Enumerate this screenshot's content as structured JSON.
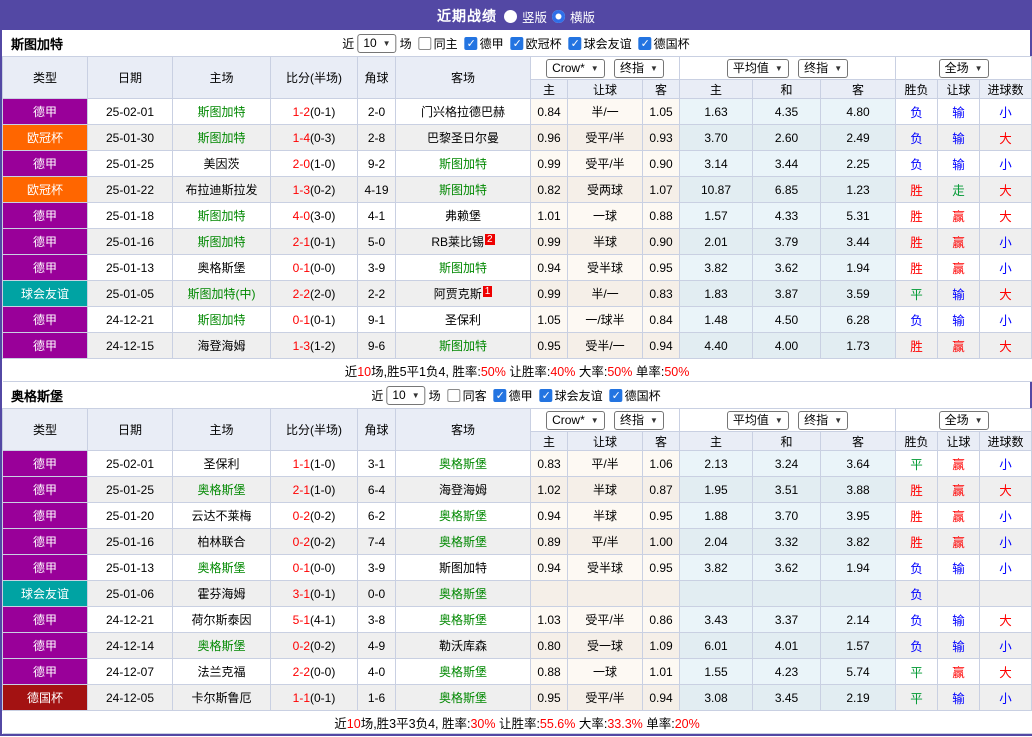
{
  "title_bar": {
    "title": "近期战绩",
    "radios": [
      {
        "label": "竖版",
        "checked": false
      },
      {
        "label": "横版",
        "checked": true
      }
    ]
  },
  "selects": {
    "odds_source": "Crow*",
    "odds_time": "终指",
    "avg": "平均值",
    "avg_time": "终指",
    "scope": "全场"
  },
  "columns": [
    "类型",
    "日期",
    "主场",
    "比分(半场)",
    "角球",
    "客场",
    "主",
    "让球",
    "客",
    "主",
    "和",
    "客",
    "胜负",
    "让球",
    "进球数"
  ],
  "colors": {
    "red": "#FF0000",
    "team_green": "#008800",
    "type": {
      "德甲": "#990099",
      "欧冠杯": "#FF6600",
      "球会友谊": "#00A3A3",
      "德国杯": "#A31212"
    },
    "result": {
      "胜": "#FF0000",
      "平": "#009933",
      "负": "#0000FF",
      "赢": "#FF0000",
      "走": "#009933",
      "输": "#0000FF",
      "大": "#FF0000",
      "小": "#0000FF"
    }
  },
  "tables": [
    {
      "team": "斯图加特",
      "filter": {
        "prefix": "近",
        "count": "10",
        "suffix": "场",
        "same_label": "同主",
        "same_checked": false,
        "leagues": [
          {
            "label": "德甲",
            "checked": true
          },
          {
            "label": "欧冠杯",
            "checked": true
          },
          {
            "label": "球会友谊",
            "checked": true
          },
          {
            "label": "德国杯",
            "checked": true
          }
        ]
      },
      "rows": [
        {
          "type": "德甲",
          "date": "25-02-01",
          "home": {
            "name": "斯图加特",
            "self": true
          },
          "score": "1-2",
          "half": "(0-1)",
          "corner": "2-0",
          "away": {
            "name": "门兴格拉德巴赫"
          },
          "odds": [
            "0.84",
            "半/一",
            "1.05"
          ],
          "avg": [
            "1.63",
            "4.35",
            "4.80"
          ],
          "result": [
            "负",
            "输",
            "小"
          ]
        },
        {
          "type": "欧冠杯",
          "date": "25-01-30",
          "home": {
            "name": "斯图加特",
            "self": true
          },
          "score": "1-4",
          "half": "(0-3)",
          "corner": "2-8",
          "away": {
            "name": "巴黎圣日尔曼"
          },
          "odds": [
            "0.96",
            "受平/半",
            "0.93"
          ],
          "avg": [
            "3.70",
            "2.60",
            "2.49"
          ],
          "result": [
            "负",
            "输",
            "大"
          ]
        },
        {
          "type": "德甲",
          "date": "25-01-25",
          "home": {
            "name": "美因茨"
          },
          "score": "2-0",
          "half": "(1-0)",
          "corner": "9-2",
          "away": {
            "name": "斯图加特",
            "self": true
          },
          "odds": [
            "0.99",
            "受平/半",
            "0.90"
          ],
          "avg": [
            "3.14",
            "3.44",
            "2.25"
          ],
          "result": [
            "负",
            "输",
            "小"
          ]
        },
        {
          "type": "欧冠杯",
          "date": "25-01-22",
          "home": {
            "name": "布拉迪斯拉发"
          },
          "score": "1-3",
          "half": "(0-2)",
          "corner": "4-19",
          "away": {
            "name": "斯图加特",
            "self": true
          },
          "odds": [
            "0.82",
            "受两球",
            "1.07"
          ],
          "avg": [
            "10.87",
            "6.85",
            "1.23"
          ],
          "result": [
            "胜",
            "走",
            "大"
          ]
        },
        {
          "type": "德甲",
          "date": "25-01-18",
          "home": {
            "name": "斯图加特",
            "self": true
          },
          "score": "4-0",
          "half": "(3-0)",
          "corner": "4-1",
          "away": {
            "name": "弗赖堡"
          },
          "odds": [
            "1.01",
            "一球",
            "0.88"
          ],
          "avg": [
            "1.57",
            "4.33",
            "5.31"
          ],
          "result": [
            "胜",
            "赢",
            "大"
          ]
        },
        {
          "type": "德甲",
          "date": "25-01-16",
          "home": {
            "name": "斯图加特",
            "self": true
          },
          "score": "2-1",
          "half": "(0-1)",
          "corner": "5-0",
          "away": {
            "name": "RB莱比锡",
            "badge": "2"
          },
          "odds": [
            "0.99",
            "半球",
            "0.90"
          ],
          "avg": [
            "2.01",
            "3.79",
            "3.44"
          ],
          "result": [
            "胜",
            "赢",
            "小"
          ]
        },
        {
          "type": "德甲",
          "date": "25-01-13",
          "home": {
            "name": "奥格斯堡"
          },
          "score": "0-1",
          "half": "(0-0)",
          "corner": "3-9",
          "away": {
            "name": "斯图加特",
            "self": true
          },
          "odds": [
            "0.94",
            "受半球",
            "0.95"
          ],
          "avg": [
            "3.82",
            "3.62",
            "1.94"
          ],
          "result": [
            "胜",
            "赢",
            "小"
          ]
        },
        {
          "type": "球会友谊",
          "date": "25-01-05",
          "home": {
            "name": "斯图加特(中)",
            "self": true
          },
          "score": "2-2",
          "half": "(2-0)",
          "corner": "2-2",
          "away": {
            "name": "阿贾克斯",
            "badge": "1"
          },
          "odds": [
            "0.99",
            "半/一",
            "0.83"
          ],
          "avg": [
            "1.83",
            "3.87",
            "3.59"
          ],
          "result": [
            "平",
            "输",
            "大"
          ]
        },
        {
          "type": "德甲",
          "date": "24-12-21",
          "home": {
            "name": "斯图加特",
            "self": true
          },
          "score": "0-1",
          "half": "(0-1)",
          "corner": "9-1",
          "away": {
            "name": "圣保利"
          },
          "odds": [
            "1.05",
            "一/球半",
            "0.84"
          ],
          "avg": [
            "1.48",
            "4.50",
            "6.28"
          ],
          "result": [
            "负",
            "输",
            "小"
          ]
        },
        {
          "type": "德甲",
          "date": "24-12-15",
          "home": {
            "name": "海登海姆"
          },
          "score": "1-3",
          "half": "(1-2)",
          "corner": "9-6",
          "away": {
            "name": "斯图加特",
            "self": true
          },
          "odds": [
            "0.95",
            "受半/一",
            "0.94"
          ],
          "avg": [
            "4.40",
            "4.00",
            "1.73"
          ],
          "result": [
            "胜",
            "赢",
            "大"
          ]
        }
      ],
      "summary": [
        {
          "text": "近"
        },
        {
          "text": "10",
          "red": true
        },
        {
          "text": "场,胜5平1负4, 胜率:"
        },
        {
          "text": "50%",
          "red": true
        },
        {
          "text": " 让胜率:"
        },
        {
          "text": "40%",
          "red": true
        },
        {
          "text": " 大率:"
        },
        {
          "text": "50%",
          "red": true
        },
        {
          "text": " 单率:"
        },
        {
          "text": "50%",
          "red": true
        }
      ]
    },
    {
      "team": "奥格斯堡",
      "filter": {
        "prefix": "近",
        "count": "10",
        "suffix": "场",
        "same_label": "同客",
        "same_checked": false,
        "leagues": [
          {
            "label": "德甲",
            "checked": true
          },
          {
            "label": "球会友谊",
            "checked": true
          },
          {
            "label": "德国杯",
            "checked": true
          }
        ]
      },
      "rows": [
        {
          "type": "德甲",
          "date": "25-02-01",
          "home": {
            "name": "圣保利"
          },
          "score": "1-1",
          "half": "(1-0)",
          "corner": "3-1",
          "away": {
            "name": "奥格斯堡",
            "self": true
          },
          "odds": [
            "0.83",
            "平/半",
            "1.06"
          ],
          "avg": [
            "2.13",
            "3.24",
            "3.64"
          ],
          "result": [
            "平",
            "赢",
            "小"
          ]
        },
        {
          "type": "德甲",
          "date": "25-01-25",
          "home": {
            "name": "奥格斯堡",
            "self": true
          },
          "score": "2-1",
          "half": "(1-0)",
          "corner": "6-4",
          "away": {
            "name": "海登海姆"
          },
          "odds": [
            "1.02",
            "半球",
            "0.87"
          ],
          "avg": [
            "1.95",
            "3.51",
            "3.88"
          ],
          "result": [
            "胜",
            "赢",
            "大"
          ]
        },
        {
          "type": "德甲",
          "date": "25-01-20",
          "home": {
            "name": "云达不莱梅"
          },
          "score": "0-2",
          "half": "(0-2)",
          "corner": "6-2",
          "away": {
            "name": "奥格斯堡",
            "self": true
          },
          "odds": [
            "0.94",
            "半球",
            "0.95"
          ],
          "avg": [
            "1.88",
            "3.70",
            "3.95"
          ],
          "result": [
            "胜",
            "赢",
            "小"
          ]
        },
        {
          "type": "德甲",
          "date": "25-01-16",
          "home": {
            "name": "柏林联合"
          },
          "score": "0-2",
          "half": "(0-2)",
          "corner": "7-4",
          "away": {
            "name": "奥格斯堡",
            "self": true
          },
          "odds": [
            "0.89",
            "平/半",
            "1.00"
          ],
          "avg": [
            "2.04",
            "3.32",
            "3.82"
          ],
          "result": [
            "胜",
            "赢",
            "小"
          ]
        },
        {
          "type": "德甲",
          "date": "25-01-13",
          "home": {
            "name": "奥格斯堡",
            "self": true
          },
          "score": "0-1",
          "half": "(0-0)",
          "corner": "3-9",
          "away": {
            "name": "斯图加特"
          },
          "odds": [
            "0.94",
            "受半球",
            "0.95"
          ],
          "avg": [
            "3.82",
            "3.62",
            "1.94"
          ],
          "result": [
            "负",
            "输",
            "小"
          ]
        },
        {
          "type": "球会友谊",
          "date": "25-01-06",
          "home": {
            "name": "霍芬海姆"
          },
          "score": "3-1",
          "half": "(0-1)",
          "corner": "0-0",
          "away": {
            "name": "奥格斯堡",
            "self": true
          },
          "odds": [
            "",
            "",
            ""
          ],
          "avg": [
            "",
            "",
            ""
          ],
          "result": [
            "负",
            "",
            ""
          ]
        },
        {
          "type": "德甲",
          "date": "24-12-21",
          "home": {
            "name": "荷尔斯泰因"
          },
          "score": "5-1",
          "half": "(4-1)",
          "corner": "3-8",
          "away": {
            "name": "奥格斯堡",
            "self": true
          },
          "odds": [
            "1.03",
            "受平/半",
            "0.86"
          ],
          "avg": [
            "3.43",
            "3.37",
            "2.14"
          ],
          "result": [
            "负",
            "输",
            "大"
          ]
        },
        {
          "type": "德甲",
          "date": "24-12-14",
          "home": {
            "name": "奥格斯堡",
            "self": true
          },
          "score": "0-2",
          "half": "(0-2)",
          "corner": "4-9",
          "away": {
            "name": "勒沃库森"
          },
          "odds": [
            "0.80",
            "受一球",
            "1.09"
          ],
          "avg": [
            "6.01",
            "4.01",
            "1.57"
          ],
          "result": [
            "负",
            "输",
            "小"
          ]
        },
        {
          "type": "德甲",
          "date": "24-12-07",
          "home": {
            "name": "法兰克福"
          },
          "score": "2-2",
          "half": "(0-0)",
          "corner": "4-0",
          "away": {
            "name": "奥格斯堡",
            "self": true
          },
          "odds": [
            "0.88",
            "一球",
            "1.01"
          ],
          "avg": [
            "1.55",
            "4.23",
            "5.74"
          ],
          "result": [
            "平",
            "赢",
            "大"
          ]
        },
        {
          "type": "德国杯",
          "date": "24-12-05",
          "home": {
            "name": "卡尔斯鲁厄"
          },
          "score": "1-1",
          "half": "(0-1)",
          "corner": "1-6",
          "away": {
            "name": "奥格斯堡",
            "self": true
          },
          "odds": [
            "0.95",
            "受平/半",
            "0.94"
          ],
          "avg": [
            "3.08",
            "3.45",
            "2.19"
          ],
          "result": [
            "平",
            "输",
            "小"
          ]
        }
      ],
      "summary": [
        {
          "text": "近"
        },
        {
          "text": "10",
          "red": true
        },
        {
          "text": "场,胜3平3负4, 胜率:"
        },
        {
          "text": "30%",
          "red": true
        },
        {
          "text": " 让胜率:"
        },
        {
          "text": "55.6%",
          "red": true
        },
        {
          "text": " 大率:"
        },
        {
          "text": "33.3%",
          "red": true
        },
        {
          "text": " 单率:"
        },
        {
          "text": "20%",
          "red": true
        }
      ]
    }
  ]
}
